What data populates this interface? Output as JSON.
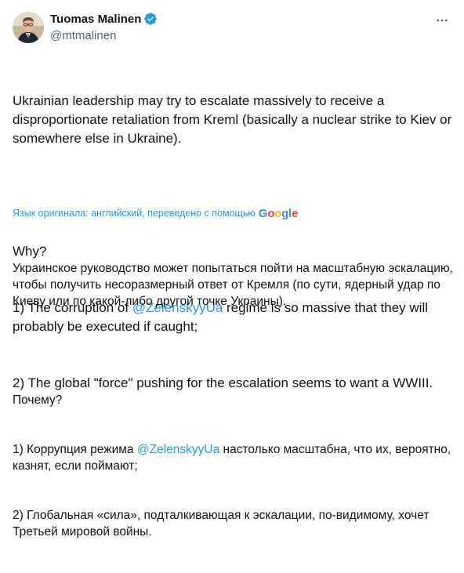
{
  "author": {
    "display_name": "Tuomas Malinen",
    "handle": "@mtmalinen",
    "verified": true,
    "verified_color": "#1d9bf0"
  },
  "icons": {
    "verified": "verified-badge-icon",
    "more": "more-options-icon",
    "google": "google-logo-icon"
  },
  "tweet": {
    "paragraph1": "Ukrainian leadership may try to escalate massively to receive a disproportionate retaliation from Kreml (basically a nuclear strike to Kiev or somewhere else in Ukraine).",
    "why": "Why?",
    "point1_pre": "1) The corruption of ",
    "point1_mention": "@ZelenskyyUa",
    "point1_post": " regime is so massive that they will probably be executed if caught;",
    "point2": "2) The global \"force\" pushing for the escalation seems to want a WWIII."
  },
  "translation": {
    "note": "Язык оригинала: английский, переведено с помощью",
    "provider": "Google",
    "paragraph1": "Украинское руководство может попытаться пойти на масштабную эскалацию, чтобы получить несоразмерный ответ от Кремля (по сути, ядерный удар по Киеву или по какой-либо другой точке Украины).",
    "why": "Почему?",
    "point1_pre": "1) Коррупция режима ",
    "point1_mention": "@ZelenskyyUa",
    "point1_post": " настолько масштабна, что их, вероятно, казнят, если поймают;",
    "point2": "2) Глобальная «сила», подталкивающая к эскалации, по-видимому, хочет Третьей мировой войны."
  },
  "colors": {
    "text": "#0f1419",
    "secondary": "#536471",
    "link": "#1d9bf0"
  }
}
